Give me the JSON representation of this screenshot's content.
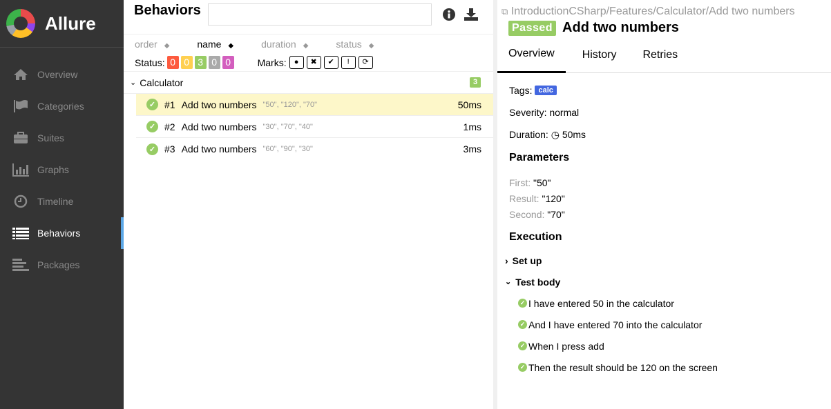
{
  "app": {
    "name": "Allure"
  },
  "sidebar": {
    "items": [
      {
        "label": "Overview",
        "icon": "home-icon"
      },
      {
        "label": "Categories",
        "icon": "flag-icon"
      },
      {
        "label": "Suites",
        "icon": "briefcase-icon"
      },
      {
        "label": "Graphs",
        "icon": "bar-chart-icon"
      },
      {
        "label": "Timeline",
        "icon": "clock-icon"
      },
      {
        "label": "Behaviors",
        "icon": "list-icon",
        "active": true
      },
      {
        "label": "Packages",
        "icon": "align-left-icon"
      }
    ]
  },
  "behaviors": {
    "title": "Behaviors",
    "search_placeholder": "",
    "sort": [
      "order",
      "name",
      "duration",
      "status"
    ],
    "status_label": "Status:",
    "status_counts": [
      {
        "value": "0",
        "color": "#fd5a3e"
      },
      {
        "value": "0",
        "color": "#ffd050"
      },
      {
        "value": "3",
        "color": "#97cc64"
      },
      {
        "value": "0",
        "color": "#aaaaaa"
      },
      {
        "value": "0",
        "color": "#d35ebe"
      }
    ],
    "marks_label": "Marks:",
    "group": {
      "name": "Calculator",
      "count": "3"
    },
    "rows": [
      {
        "num": "#1",
        "name": "Add two numbers",
        "params": "\"50\", \"120\", \"70\"",
        "duration": "50ms"
      },
      {
        "num": "#2",
        "name": "Add two numbers",
        "params": "\"30\", \"70\", \"40\"",
        "duration": "1ms"
      },
      {
        "num": "#3",
        "name": "Add two numbers",
        "params": "\"60\", \"90\", \"30\"",
        "duration": "3ms"
      }
    ]
  },
  "detail": {
    "breadcrumb": "IntroductionCSharp/Features/Calculator/Add two numbers",
    "status": "Passed",
    "title": "Add two numbers",
    "tabs": [
      "Overview",
      "History",
      "Retries"
    ],
    "tags_label": "Tags:",
    "tag": "calc",
    "severity": "Severity: normal",
    "duration_label": "Duration:",
    "duration": "50ms",
    "parameters_title": "Parameters",
    "parameters": [
      {
        "k": "First:",
        "v": "\"50\""
      },
      {
        "k": "Result:",
        "v": "\"120\""
      },
      {
        "k": "Second:",
        "v": "\"70\""
      }
    ],
    "execution_title": "Execution",
    "setup": "Set up",
    "test_body": "Test body",
    "steps": [
      "I have entered 50 in the calculator",
      "And I have entered 70 into the calculator",
      "When I press add",
      "Then the result should be 120 on the screen"
    ]
  }
}
